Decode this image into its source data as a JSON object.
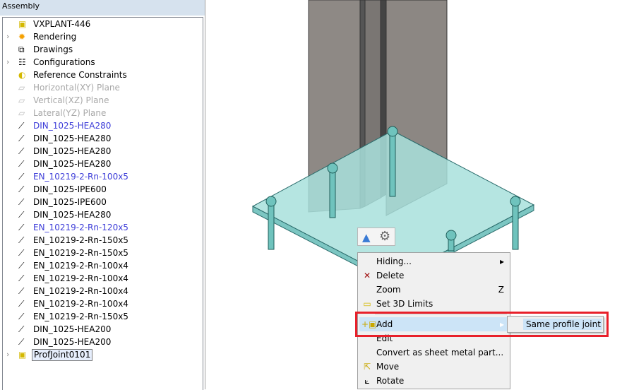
{
  "panel": {
    "title": "Assembly"
  },
  "tree": [
    {
      "label": "VXPLANT-446",
      "icon": "assembly-icon",
      "state": "normal",
      "expand": false
    },
    {
      "label": "Rendering",
      "icon": "sun-icon",
      "state": "normal",
      "expand": true
    },
    {
      "label": "Drawings",
      "icon": "drawings-icon",
      "state": "normal",
      "expand": false
    },
    {
      "label": "Configurations",
      "icon": "configurations-icon",
      "state": "normal",
      "expand": true
    },
    {
      "label": "Reference Constraints",
      "icon": "constraint-icon",
      "state": "normal",
      "expand": false
    },
    {
      "label": "Horizontal(XY) Plane",
      "icon": "plane-icon",
      "state": "disabled",
      "expand": false
    },
    {
      "label": "Vertical(XZ) Plane",
      "icon": "plane-icon",
      "state": "disabled",
      "expand": false
    },
    {
      "label": "Lateral(YZ) Plane",
      "icon": "plane-icon",
      "state": "disabled",
      "expand": false
    },
    {
      "label": "DIN_1025-HEA280",
      "icon": "profile-icon",
      "state": "blue",
      "expand": false
    },
    {
      "label": "DIN_1025-HEA280",
      "icon": "profile-icon",
      "state": "normal",
      "expand": false
    },
    {
      "label": "DIN_1025-HEA280",
      "icon": "profile-icon",
      "state": "normal",
      "expand": false
    },
    {
      "label": "DIN_1025-HEA280",
      "icon": "profile-icon",
      "state": "normal",
      "expand": false
    },
    {
      "label": "EN_10219-2-Rn-100x5",
      "icon": "profile-icon",
      "state": "blue",
      "expand": false
    },
    {
      "label": "DIN_1025-IPE600",
      "icon": "profile-icon",
      "state": "normal",
      "expand": false
    },
    {
      "label": "DIN_1025-IPE600",
      "icon": "profile-icon",
      "state": "normal",
      "expand": false
    },
    {
      "label": "DIN_1025-HEA280",
      "icon": "profile-icon",
      "state": "normal",
      "expand": false
    },
    {
      "label": "EN_10219-2-Rn-120x5",
      "icon": "profile-icon",
      "state": "blue",
      "expand": false
    },
    {
      "label": "EN_10219-2-Rn-150x5",
      "icon": "profile-icon",
      "state": "normal",
      "expand": false
    },
    {
      "label": "EN_10219-2-Rn-150x5",
      "icon": "profile-icon",
      "state": "normal",
      "expand": false
    },
    {
      "label": "EN_10219-2-Rn-100x4",
      "icon": "profile-icon",
      "state": "normal",
      "expand": false
    },
    {
      "label": "EN_10219-2-Rn-100x4",
      "icon": "profile-icon",
      "state": "normal",
      "expand": false
    },
    {
      "label": "EN_10219-2-Rn-100x4",
      "icon": "profile-icon",
      "state": "normal",
      "expand": false
    },
    {
      "label": "EN_10219-2-Rn-100x4",
      "icon": "profile-icon",
      "state": "normal",
      "expand": false
    },
    {
      "label": "EN_10219-2-Rn-150x5",
      "icon": "profile-icon",
      "state": "normal",
      "expand": false
    },
    {
      "label": "DIN_1025-HEA200",
      "icon": "profile-icon",
      "state": "normal",
      "expand": false
    },
    {
      "label": "DIN_1025-HEA200",
      "icon": "profile-icon",
      "state": "normal",
      "expand": false
    },
    {
      "label": "ProfJoint0101",
      "icon": "assembly-icon",
      "state": "selected",
      "expand": true
    }
  ],
  "menu": [
    {
      "label": "Hiding...",
      "icon": "",
      "shortcut": "",
      "submenu": true
    },
    {
      "label": "Delete",
      "icon": "delete-icon",
      "shortcut": "",
      "submenu": false
    },
    {
      "label": "Zoom",
      "icon": "",
      "shortcut": "Z",
      "submenu": false
    },
    {
      "label": "Set 3D Limits",
      "icon": "limits-icon",
      "shortcut": "",
      "submenu": false
    },
    {
      "label": "Add",
      "icon": "add-icon",
      "shortcut": "",
      "submenu": true
    },
    {
      "label": "Edit",
      "icon": "",
      "shortcut": "",
      "submenu": false
    },
    {
      "label": "Convert as sheet metal part...",
      "icon": "",
      "shortcut": "",
      "submenu": false
    },
    {
      "label": "Move",
      "icon": "move-icon",
      "shortcut": "",
      "submenu": false
    },
    {
      "label": "Rotate",
      "icon": "rotate-icon",
      "shortcut": "",
      "submenu": false
    }
  ],
  "submenu": {
    "item": "Same profile joint"
  },
  "colors": {
    "highlight": "#cce4f7",
    "callout": "#e8202a",
    "plate": "#9fdcd8",
    "column": "#8e8985"
  }
}
